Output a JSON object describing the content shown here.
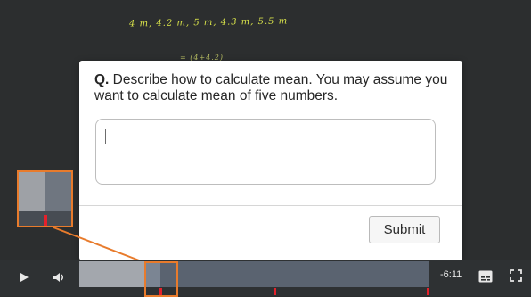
{
  "video": {
    "handwriting_line1": "4 m, 4.2 m, 5 m, 4.3 m, 5.5 m",
    "handwriting_line2": "= (4+4.2)"
  },
  "dialog": {
    "question_prefix": "Q.",
    "question_text": " Describe how to calculate mean. You may assume you want to calculate mean of five numbers.",
    "answer_value": "",
    "submit_label": "Submit"
  },
  "player": {
    "time_remaining": "-6:11",
    "progress_fraction": 0.19,
    "icons": {
      "play": "play-icon",
      "volume": "volume-icon",
      "captions": "captions-icon",
      "fullscreen": "fullscreen-icon"
    },
    "colors": {
      "accent": "#e87b2c",
      "marker": "#e5212b",
      "played": "#a3a7ad",
      "track": "#5a6370"
    }
  }
}
